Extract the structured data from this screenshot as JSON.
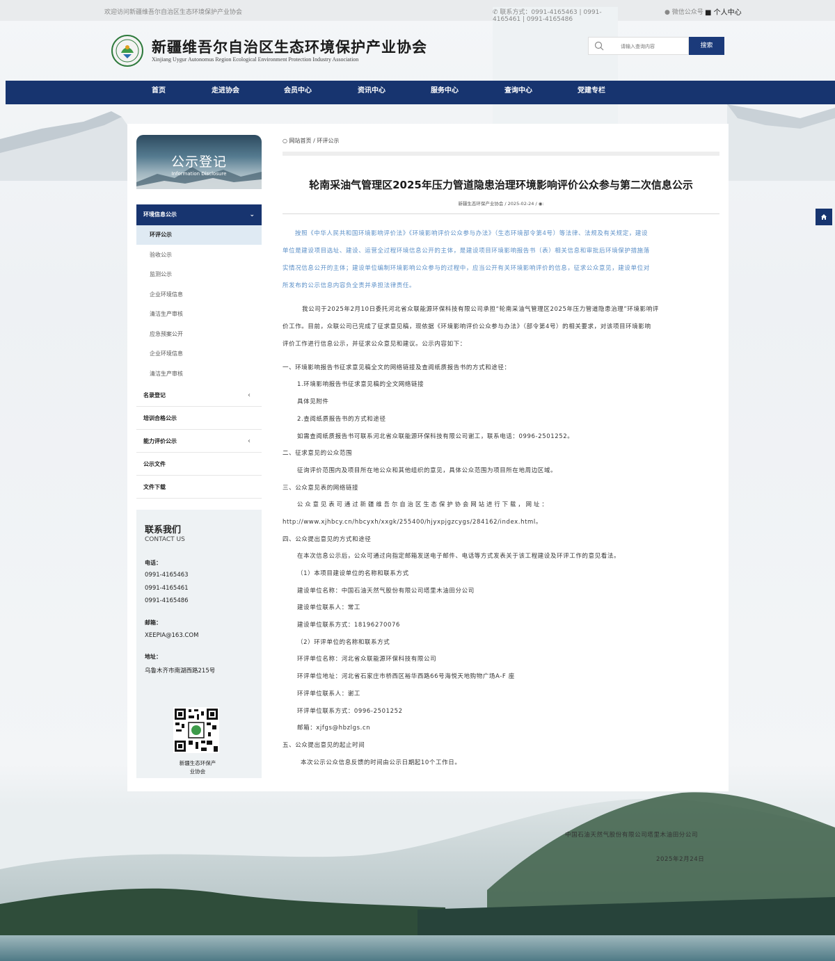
{
  "topbar": {
    "welcome": "欢迎访问新疆维吾尔自治区生态环境保护产业协会",
    "contact": "联系方式：0991-4165463 | 0991-4165461 | 0991-4165486",
    "wechat": "微信公众号",
    "user_center": "个人中心"
  },
  "header": {
    "title": "新疆维吾尔自治区生态环境保护产业协会",
    "subtitle": "Xinjiang Uygur Autonomus Region Ecological Environment Protection Industry Association",
    "search_placeholder": "请输入查询内容",
    "search_button": "搜索"
  },
  "nav": [
    "首页",
    "走进协会",
    "会员中心",
    "资讯中心",
    "服务中心",
    "查询中心",
    "党建专栏"
  ],
  "sidebar": {
    "banner_title": "公示登记",
    "banner_subtitle": "Information Disclosure",
    "section_head": "环境信息公示",
    "sub_items": [
      "环评公示",
      "验收公示",
      "监测公示",
      "企业环境信息",
      "清洁生产审核",
      "应急预案公开",
      "企业环境信息",
      "清洁生产审核"
    ],
    "categories": [
      "名录登记",
      "培训合格公示",
      "能力评价公示",
      "公示文件",
      "文件下载"
    ]
  },
  "contact": {
    "title": "联系我们",
    "title_en": "CONTACT US",
    "phone_label": "电话：",
    "phones": [
      "0991-4165463",
      "0991-4165461",
      "0991-4165486"
    ],
    "email_label": "邮箱：",
    "email": "XEEPIA@163.COM",
    "address_label": "地址：",
    "address": "乌鲁木齐市南湖西路215号",
    "qr_caption_1": "新疆生态环保产",
    "qr_caption_2": "业协会"
  },
  "breadcrumb": {
    "home": "网站首页",
    "sep": "/",
    "current": "环评公示"
  },
  "article": {
    "title": "轮南采油气管理区2025年压力管道隐患治理环境影响评价公众参与第二次信息公示",
    "meta": "新疆生态环保产业协会 / 2025-02-24 / ",
    "intro": [
      "按照《中华人民共和国环境影响评价法》《环境影响评价公众参与办法》（生态环境部令第4号）等法律、法规及有关规定，建设",
      "单位是建设项目选址、建设、运营全过程环境信息公开的主体，是建设项目环境影响报告书（表）相关信息和审批后环境保护措施落",
      "实情况信息公开的主体；建设单位编制环境影响公众参与的过程中，应当公开有关环境影响评价的信息，征求公众意见，建设单位对",
      "所发布的公示信息内容负全责并承担法律责任。"
    ],
    "para2": [
      "我公司于2025年2月10日委托河北省众联能源环保科技有限公司承担“轮南采油气管理区2025年压力管道隐患治理”环境影响评",
      "价工作。目前，众联公司已完成了征求意见稿，现依据《环境影响评价公众参与办法》（部令第4号）的相关要求，对该项目环境影响",
      "评价工作进行信息公示，并征求公众意见和建议。公示内容如下："
    ],
    "lines": [
      "一、环境影响报告书征求意见稿全文的网络链接及查阅纸质报告书的方式和途径：",
      "1.环境影响报告书征求意见稿的全文网络链接",
      "具体见附件",
      "2.查阅纸质报告书的方式和途径",
      "如需查阅纸质报告书可联系河北省众联能源环保科技有限公司谢工，联系电话：0996-2501252。",
      "二、征求意见的公众范围",
      "征询评价范围内及项目所在地公众和其他组织的意见，具体公众范围为项目所在地周边区域。",
      "三、公众意见表的网络链接",
      "公 众 意 见 表 可 通 过 新 疆 维 吾 尔 自 治 区 生 态 保 护 协 会 网 站 进 行 下 载 ， 网 址 ：",
      "http://www.xjhbcy.cn/hbcyxh/xxgk/255400/hjyxpjgzcygs/284162/index.html。",
      "四、公众提出意见的方式和途径",
      "在本次信息公示后，公众可通过向指定邮箱发送电子邮件、电话等方式发表关于该工程建设及环评工作的意见看法。",
      "（1）本项目建设单位的名称和联系方式",
      "建设单位名称：中国石油天然气股份有限公司塔里木油田分公司",
      "建设单位联系人：常工",
      "建设单位联系方式：18196270076",
      "（2）环评单位的名称和联系方式",
      "环评单位名称：河北省众联能源环保科技有限公司",
      "环评单位地址：河北省石家庄市桥西区裕华西路66号海悦天地购物广场A-F 座",
      "环评单位联系人：谢工",
      "环评单位联系方式：0996-2501252",
      "邮箱：xjfgs@hbzlgs.cn",
      "五、公众提出意见的起止时间",
      "本次公示公众信息反馈的时间由公示日期起10个工作日。"
    ],
    "signature_company": "中国石油天然气股份有限公司塔里木油田分公司",
    "signature_date": "2025年2月24日"
  },
  "colors": {
    "nav_bg": "#17346f",
    "accent_blue_text": "#5b8fc7",
    "active_sub_bg": "#dfeaf3"
  },
  "icons": {
    "phone": "phone-icon",
    "wechat": "wechat-icon",
    "user": "user-icon",
    "search": "search-icon",
    "eye": "eye-icon",
    "chevron_down": "chevron-down-icon",
    "chevron_left": "chevron-left-icon",
    "home": "home-icon"
  }
}
